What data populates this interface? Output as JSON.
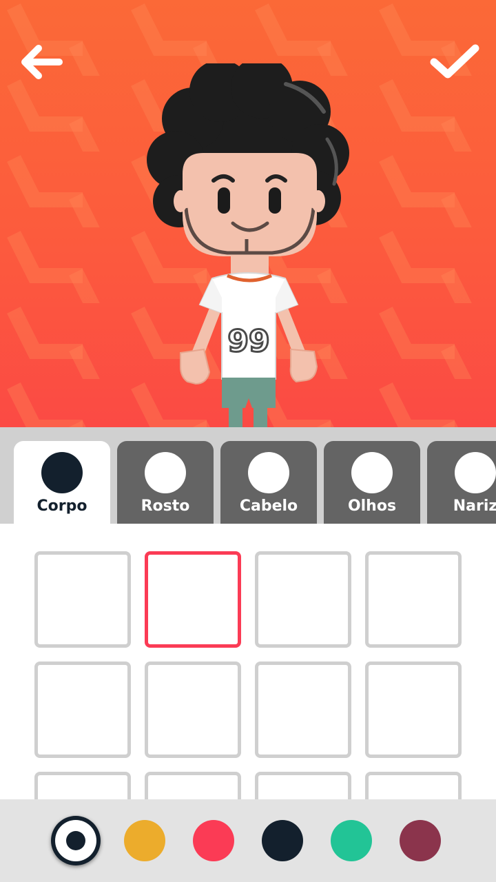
{
  "header": {
    "back_icon": "arrow-left-icon",
    "confirm_icon": "checkmark-icon"
  },
  "avatar": {
    "jersey_number": "99",
    "background_color": "#fb5b3d"
  },
  "tabs": [
    {
      "label": "Corpo",
      "active": true
    },
    {
      "label": "Rosto",
      "active": false
    },
    {
      "label": "Cabelo",
      "active": false
    },
    {
      "label": "Olhos",
      "active": false
    },
    {
      "label": "Nariz",
      "active": false
    }
  ],
  "options": {
    "selected_index": 1,
    "count": 12
  },
  "colors": [
    {
      "name": "dark-navy",
      "hex": "#13202d",
      "selected": true
    },
    {
      "name": "yellow",
      "hex": "#ecac2c",
      "selected": false
    },
    {
      "name": "red",
      "hex": "#fb3b55",
      "selected": false
    },
    {
      "name": "navy",
      "hex": "#13202d",
      "selected": false
    },
    {
      "name": "green",
      "hex": "#22c496",
      "selected": false
    },
    {
      "name": "maroon",
      "hex": "#8b344c",
      "selected": false
    }
  ],
  "accent_color": "#fb3b55"
}
